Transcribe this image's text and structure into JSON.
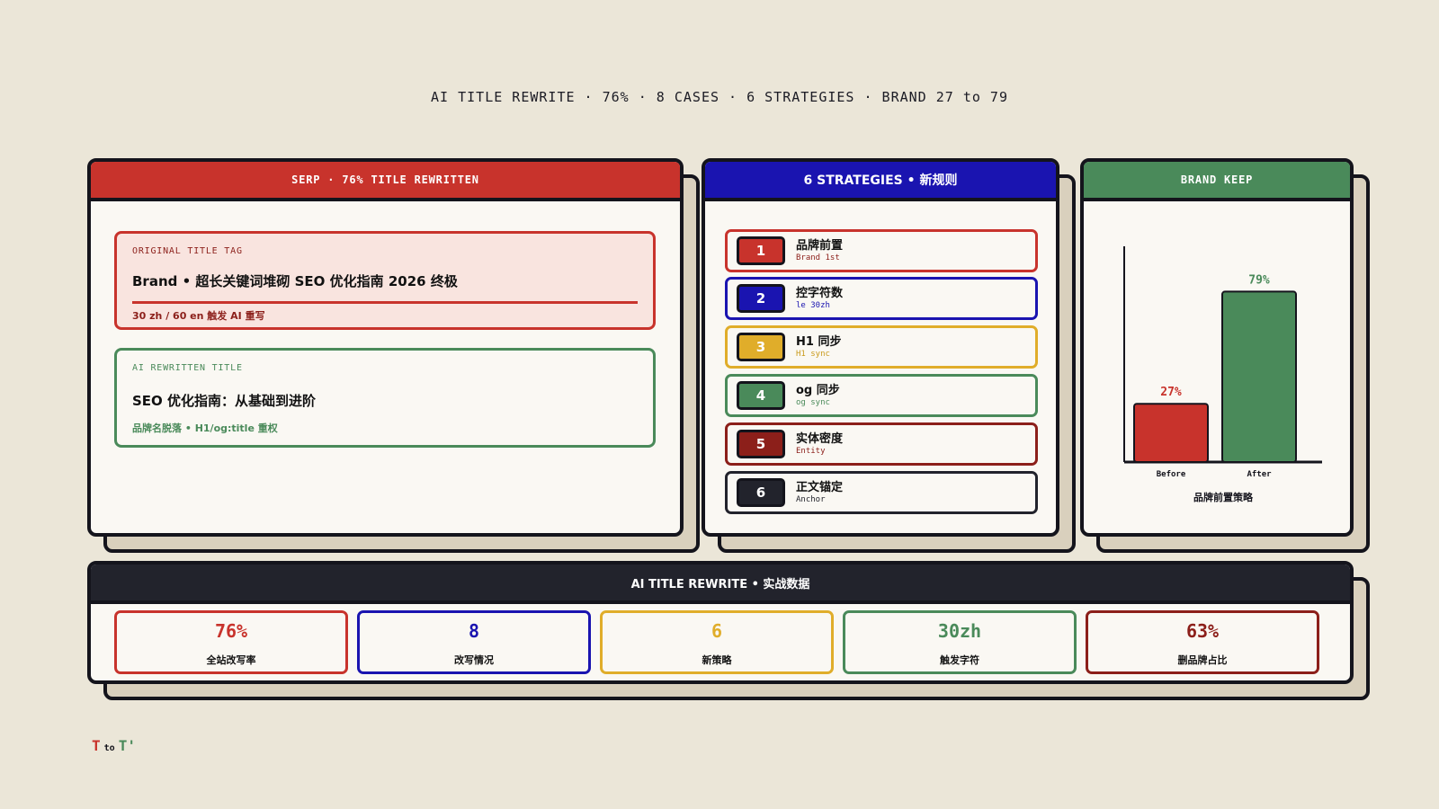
{
  "header": {
    "line": "AI TITLE REWRITE · 76% · 8 CASES · 6 STRATEGIES · BRAND 27 to 79"
  },
  "serp": {
    "title": "SERP · 76% TITLE REWRITTEN",
    "original": {
      "tag": "ORIGINAL TITLE TAG",
      "title": "Brand • 超长关键词堆砌 SEO 优化指南 2026 终极",
      "note": "30 zh / 60 en 触发 AI 重写"
    },
    "rewritten": {
      "tag": "AI REWRITTEN TITLE",
      "title": "SEO 优化指南：从基础到进阶",
      "note": "品牌名脱落 • H1/og:title 重权"
    }
  },
  "strategies": {
    "title": "6 STRATEGIES • 新规则",
    "items": [
      {
        "num": "1",
        "label": "品牌前置",
        "sub": "Brand 1st",
        "color": "#c8332c",
        "sub_color": "#8c1f1a"
      },
      {
        "num": "2",
        "label": "控字符数",
        "sub": "le 30zh",
        "color": "#1a14b0",
        "sub_color": "#1a14b0"
      },
      {
        "num": "3",
        "label": "H1 同步",
        "sub": "H1 sync",
        "color": "#e0ad2a",
        "sub_color": "#c99a1c"
      },
      {
        "num": "4",
        "label": "og 同步",
        "sub": "og sync",
        "color": "#4a8a5a",
        "sub_color": "#4a8a5a"
      },
      {
        "num": "5",
        "label": "实体密度",
        "sub": "Entity",
        "color": "#8c1f1a",
        "sub_color": "#8c1f1a"
      },
      {
        "num": "6",
        "label": "正文锚定",
        "sub": "Anchor",
        "color": "#22232c",
        "sub_color": "#22232c"
      }
    ]
  },
  "brand": {
    "title": "BRAND KEEP",
    "caption": "品牌前置策略",
    "chart_data": {
      "type": "bar",
      "categories": [
        "Before",
        "After"
      ],
      "values": [
        27,
        79
      ],
      "value_labels": [
        "27%",
        "79%"
      ],
      "colors": [
        "#c8332c",
        "#4a8a5a"
      ],
      "ylim": [
        0,
        100
      ]
    }
  },
  "stats": {
    "title": "AI TITLE REWRITE • 实战数据",
    "items": [
      {
        "value": "76%",
        "label": "全站改写率",
        "color": "#c8332c"
      },
      {
        "value": "8",
        "label": "改写情况",
        "color": "#1a14b0"
      },
      {
        "value": "6",
        "label": "新策略",
        "color": "#e0ad2a"
      },
      {
        "value": "30zh",
        "label": "触发字符",
        "color": "#4a8a5a"
      },
      {
        "value": "63%",
        "label": "删品牌占比",
        "color": "#8c1f1a"
      }
    ]
  },
  "footer": {
    "t1": "T",
    "to": "to",
    "t2": "T'"
  }
}
